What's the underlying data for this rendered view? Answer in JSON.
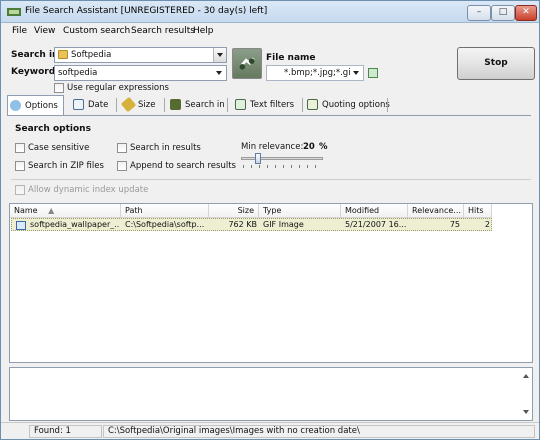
{
  "window": {
    "title": "File Search Assistant [UNREGISTERED - 30 day(s) left]",
    "min_glyph": "–",
    "max_glyph": "□",
    "close_glyph": "✕"
  },
  "menu": [
    "File",
    "View",
    "Custom search",
    "Search results",
    "Help"
  ],
  "search": {
    "search_in_label": "Search in",
    "search_in_value": "Softpedia",
    "keyword_label": "Keyword",
    "keyword_value": "softpedia",
    "use_regex_label": "Use regular expressions",
    "file_name_label": "File name",
    "file_name_value": "*.bmp;*.jpg;*.gif)",
    "stop_label": "Stop"
  },
  "tabs": [
    {
      "label": "Options",
      "icon": "gear-icon"
    },
    {
      "label": "Date",
      "icon": "calendar-icon"
    },
    {
      "label": "Size",
      "icon": "ruler-icon"
    },
    {
      "label": "Search in",
      "icon": "binoculars-icon"
    },
    {
      "label": "Text filters",
      "icon": "text-filter-icon"
    },
    {
      "label": "Quoting options",
      "icon": "quote-icon"
    }
  ],
  "options": {
    "title": "Search options",
    "case_sensitive": "Case sensitive",
    "search_in_results": "Search in results",
    "search_in_zip": "Search in ZIP files",
    "append_to_results": "Append to search results",
    "min_relevance_label": "Min relevance:",
    "min_relevance_value": "20",
    "min_relevance_unit": "%",
    "allow_dynamic": "Allow dynamic index update"
  },
  "results": {
    "columns": [
      "Name",
      "Path",
      "Size",
      "Type",
      "Modified",
      "Relevance...",
      "Hits"
    ],
    "sort_glyph": "▲",
    "rows": [
      {
        "name": "softpedia_wallpaper_...",
        "path": "C:\\Softpedia\\softp...",
        "size": "762 KB",
        "type": "GIF Image",
        "modified": "5/21/2007 16...",
        "relevance": "75",
        "hits": "2"
      }
    ]
  },
  "status": {
    "found": "Found: 1",
    "path": "C:\\Softpedia\\Original images\\Images with no creation date\\"
  },
  "colors": {
    "selected_row": "#eeeed2",
    "title_bar": "#c6d9ee"
  }
}
